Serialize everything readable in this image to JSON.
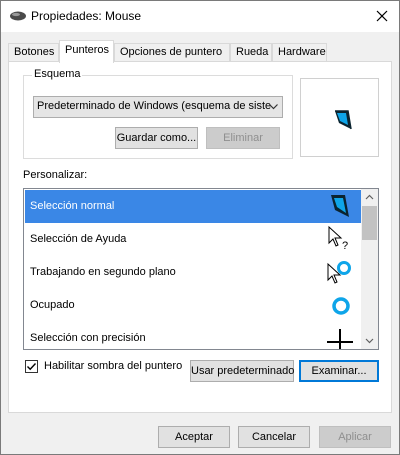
{
  "window": {
    "title": "Propiedades: Mouse",
    "close_glyph": "✕"
  },
  "tabs": [
    {
      "label": "Botones"
    },
    {
      "label": "Punteros"
    },
    {
      "label": "Opciones de puntero"
    },
    {
      "label": "Rueda"
    },
    {
      "label": "Hardware"
    }
  ],
  "scheme": {
    "group_label": "Esquema",
    "selected": "Predeterminado de Windows (esquema de siste",
    "save_label": "Guardar como...",
    "delete_label": "Eliminar"
  },
  "customize": {
    "label": "Personalizar:",
    "items": [
      {
        "label": "Selección normal",
        "icon": "normal-select-cursor-icon"
      },
      {
        "label": "Selección de Ayuda",
        "icon": "help-select-cursor-icon"
      },
      {
        "label": "Trabajando en segundo plano",
        "icon": "working-background-cursor-icon"
      },
      {
        "label": "Ocupado",
        "icon": "busy-cursor-icon"
      },
      {
        "label": "Selección con precisión",
        "icon": "precision-select-cursor-icon"
      }
    ]
  },
  "shadow": {
    "label": "Habilitar sombra del puntero",
    "checked": true
  },
  "buttons": {
    "use_default": "Usar predeterminado",
    "browse": "Examinar...",
    "accept": "Aceptar",
    "cancel": "Cancelar",
    "apply": "Aplicar"
  },
  "colors": {
    "accent": "#3a87e6",
    "cursor_blue": "#0ea5e9"
  }
}
